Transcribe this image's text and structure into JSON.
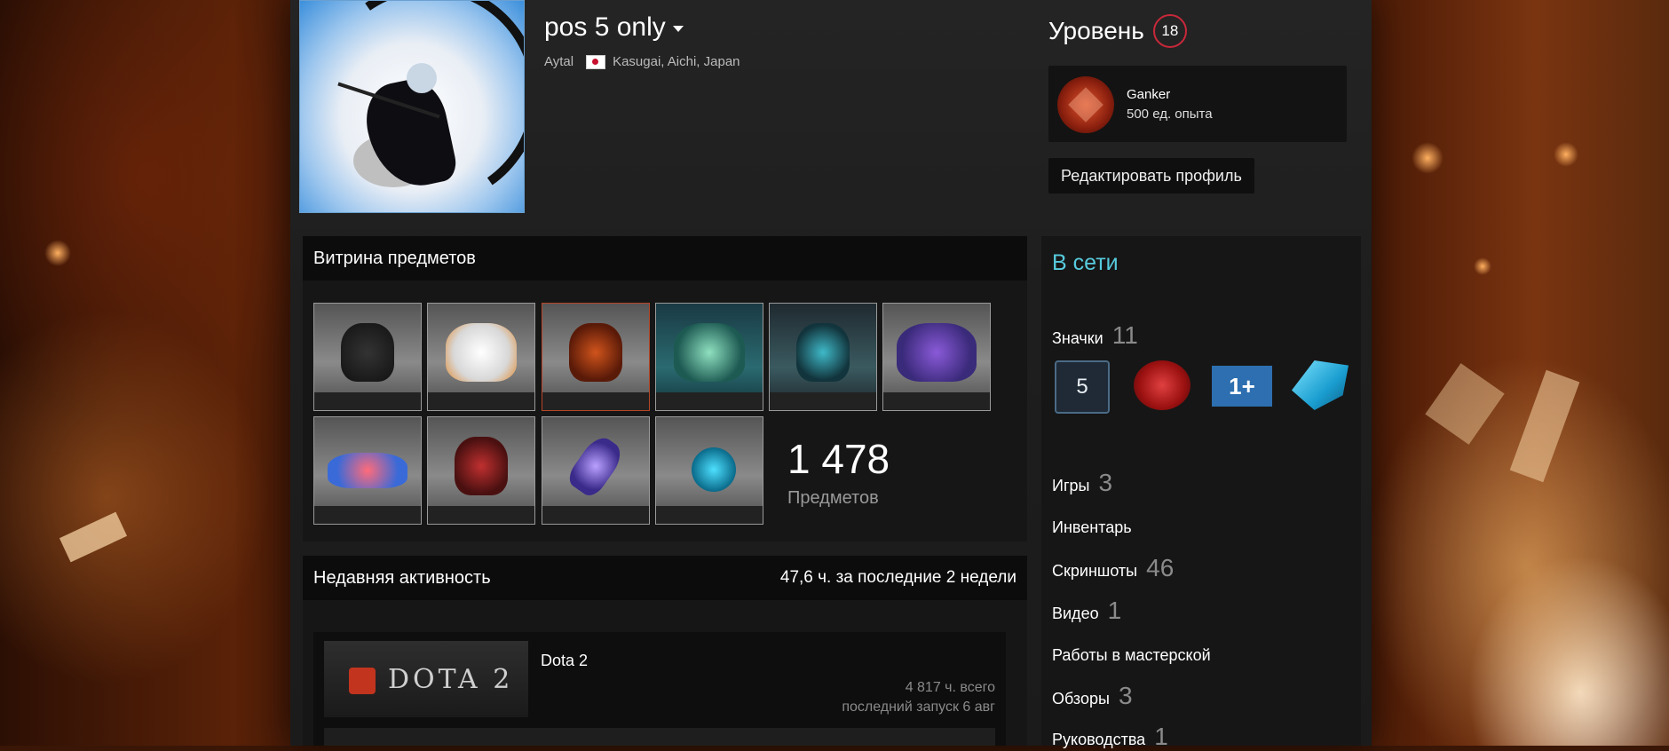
{
  "profile": {
    "persona_name": "pos 5 only",
    "real_name": "Aytal",
    "location": "Kasugai, Aichi, Japan"
  },
  "level": {
    "label": "Уровень",
    "value": "18"
  },
  "featured_badge": {
    "name": "Ganker",
    "xp": "500 ед. опыта"
  },
  "edit_profile_label": "Редактировать профиль",
  "showcase": {
    "title": "Витрина предметов",
    "item_count": "1 478",
    "item_count_label": "Предметов"
  },
  "recent": {
    "title": "Недавняя активность",
    "hours": "47,6 ч. за последние 2 недели",
    "game": {
      "name": "Dota 2",
      "logo_text": "DOTA 2",
      "total": "4 817 ч. всего",
      "last_played": "последний запуск 6 авг"
    }
  },
  "sidebar": {
    "status": "В сети",
    "badges_label": "Значки",
    "badges_count": "11",
    "badge_icons": {
      "years_text": "5",
      "one_plus_text": "1+"
    },
    "games_label": "Игры",
    "games_count": "3",
    "inventory_label": "Инвентарь",
    "screenshots_label": "Скриншоты",
    "screenshots_count": "46",
    "videos_label": "Видео",
    "videos_count": "1",
    "workshop_label": "Работы в мастерской",
    "reviews_label": "Обзоры",
    "reviews_count": "3",
    "guides_label": "Руководства",
    "guides_count": "1"
  },
  "colors": {
    "online_accent": "#57cbde",
    "level_ring": "#c8283a"
  }
}
